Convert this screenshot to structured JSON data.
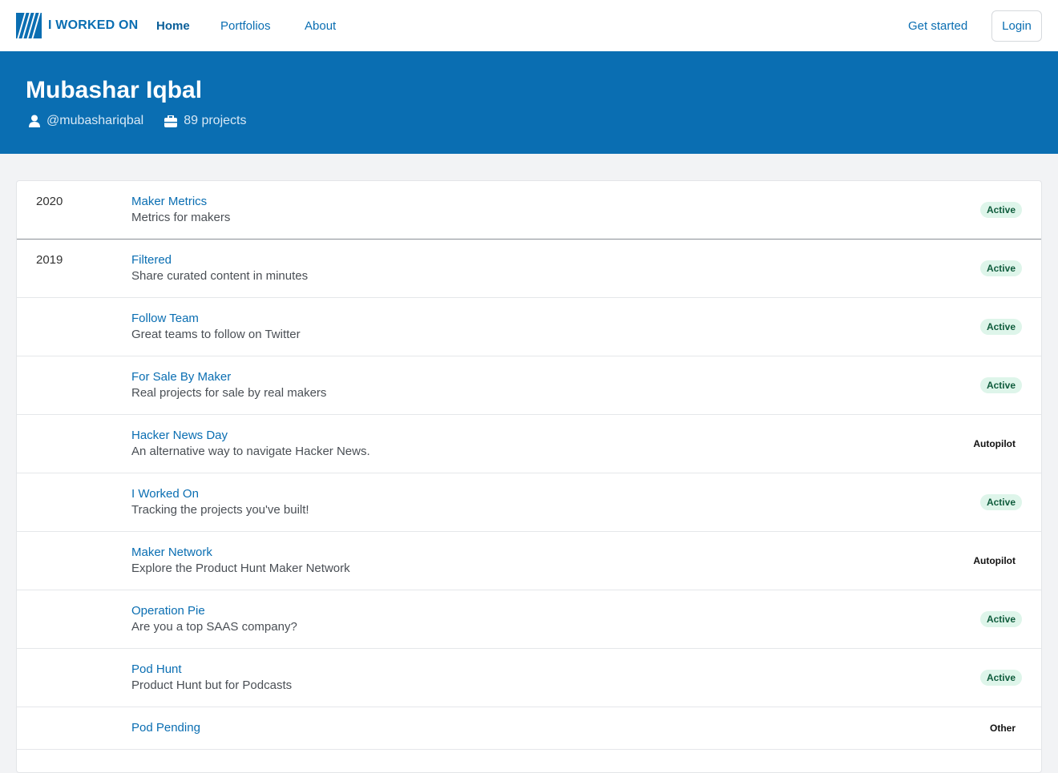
{
  "nav": {
    "brand": "I WORKED ON",
    "links": [
      {
        "label": "Home",
        "active": true
      },
      {
        "label": "Portfolios",
        "active": false
      },
      {
        "label": "About",
        "active": false
      }
    ],
    "get_started": "Get started",
    "login": "Login"
  },
  "profile": {
    "name": "Mubashar Iqbal",
    "handle": "@mubashariqbal",
    "projects": "89 projects"
  },
  "colors": {
    "brand": "#0a6eb2",
    "active_badge_bg": "#def5ea",
    "active_badge_text": "#0f5c3c"
  },
  "projects": [
    {
      "year": "2020",
      "title": "Maker Metrics",
      "desc": "Metrics for makers",
      "status": "Active"
    },
    {
      "year": "2019",
      "title": "Filtered",
      "desc": "Share curated content in minutes",
      "status": "Active"
    },
    {
      "year": "",
      "title": "Follow Team",
      "desc": "Great teams to follow on Twitter",
      "status": "Active"
    },
    {
      "year": "",
      "title": "For Sale By Maker",
      "desc": "Real projects for sale by real makers",
      "status": "Active"
    },
    {
      "year": "",
      "title": "Hacker News Day",
      "desc": "An alternative way to navigate Hacker News.",
      "status": "Autopilot"
    },
    {
      "year": "",
      "title": "I Worked On",
      "desc": "Tracking the projects you've built!",
      "status": "Active"
    },
    {
      "year": "",
      "title": "Maker Network",
      "desc": "Explore the Product Hunt Maker Network",
      "status": "Autopilot"
    },
    {
      "year": "",
      "title": "Operation Pie",
      "desc": "Are you a top SAAS company?",
      "status": "Active"
    },
    {
      "year": "",
      "title": "Pod Hunt",
      "desc": "Product Hunt but for Podcasts",
      "status": "Active"
    },
    {
      "year": "",
      "title": "Pod Pending",
      "desc": "",
      "status": "Other"
    }
  ]
}
